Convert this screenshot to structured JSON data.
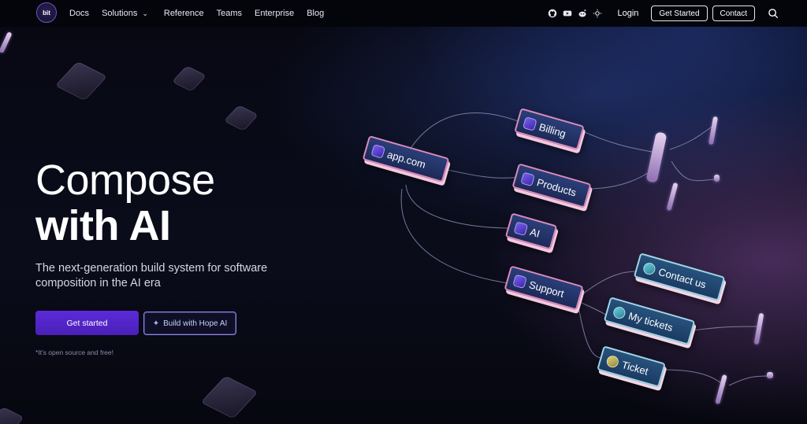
{
  "nav": {
    "logo": "bit",
    "links": [
      {
        "label": "Docs"
      },
      {
        "label": "Solutions",
        "has_dropdown": true
      },
      {
        "label": "Reference"
      },
      {
        "label": "Teams"
      },
      {
        "label": "Enterprise"
      },
      {
        "label": "Blog"
      }
    ],
    "social_icons": [
      "github-icon",
      "youtube-icon",
      "reddit-icon",
      "theme-toggle-icon"
    ],
    "login": "Login",
    "get_started": "Get Started",
    "contact": "Contact",
    "search_icon": "search-icon"
  },
  "hero": {
    "title_line1": "Compose",
    "title_line2": "with AI",
    "subtitle": "The next-generation build system for software composition in the AI era",
    "primary_button": "Get started",
    "secondary_button": "Build with Hope AI",
    "footnote": "*It's open source and free!"
  },
  "diagram": {
    "nodes": [
      "app.com",
      "Billing",
      "Products",
      "AI",
      "Support",
      "Contact us",
      "My tickets",
      "Ticket"
    ]
  },
  "colors": {
    "primary": "#5b2bd8",
    "node_border": "#d98bbf",
    "background": "#05060d"
  }
}
